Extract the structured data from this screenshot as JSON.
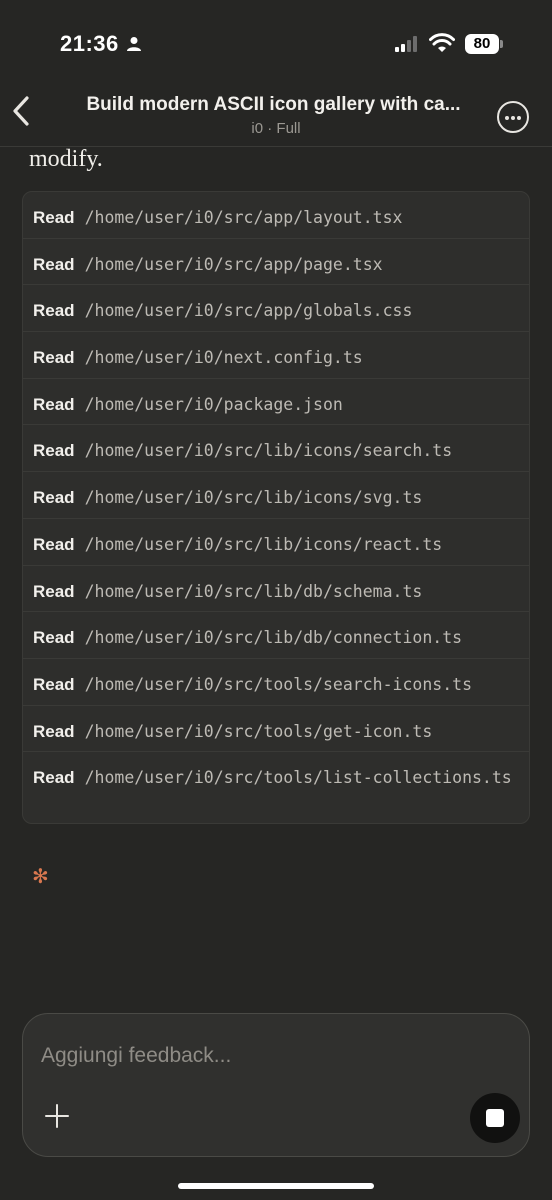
{
  "status_bar": {
    "time": "21:36",
    "battery": "80"
  },
  "header": {
    "title": "Build modern ASCII icon gallery with ca...",
    "subtitle": "i0 · Full"
  },
  "intro_text": "modify.",
  "read_label": "Read",
  "reads": [
    "/home/user/i0/src/app/layout.tsx",
    "/home/user/i0/src/app/page.tsx",
    "/home/user/i0/src/app/globals.css",
    "/home/user/i0/next.config.ts",
    "/home/user/i0/package.json",
    "/home/user/i0/src/lib/icons/search.ts",
    "/home/user/i0/src/lib/icons/svg.ts",
    "/home/user/i0/src/lib/icons/react.ts",
    "/home/user/i0/src/lib/db/schema.ts",
    "/home/user/i0/src/lib/db/connection.ts",
    "/home/user/i0/src/tools/search-icons.ts",
    "/home/user/i0/src/tools/get-icon.ts",
    "/home/user/i0/src/tools/list-collections.ts"
  ],
  "composer": {
    "placeholder": "Aggiungi feedback..."
  },
  "icons": {
    "back": "chevron-left-icon",
    "more": "ellipsis-circle-icon",
    "add": "plus-icon",
    "stop": "stop-icon",
    "thinking": "asterisk-icon"
  },
  "colors": {
    "background": "#262624",
    "accent": "#d9774f"
  }
}
